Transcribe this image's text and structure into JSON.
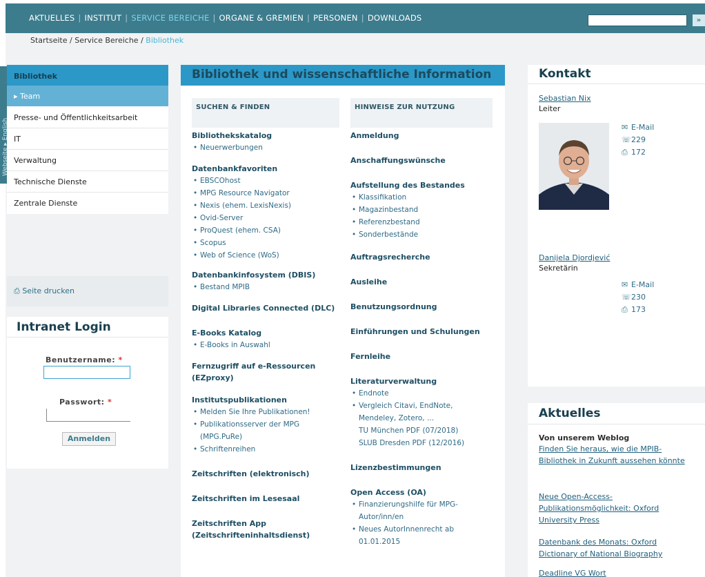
{
  "nav": {
    "items": [
      "AKTUELLES",
      "INSTITUT",
      "SERVICE BEREICHE",
      "ORGANE & GREMIEN",
      "PERSONEN",
      "DOWNLOADS"
    ],
    "active_index": 2,
    "search_button": "»"
  },
  "breadcrumb": {
    "part1": "Startseite",
    "part2": "Service Bereiche",
    "current": "Bibliothek",
    "sep": " / "
  },
  "side_tab": "Webseite ▸ English",
  "left_menu": {
    "title": "Bibliothek",
    "items": [
      {
        "label": "▸ Team",
        "active": true
      },
      {
        "label": "Presse- und Öffentlichkeitsarbeit"
      },
      {
        "label": "IT"
      },
      {
        "label": "Verwaltung"
      },
      {
        "label": "Technische Dienste"
      },
      {
        "label": "Zentrale Dienste"
      }
    ]
  },
  "print": {
    "label": "Seite drucken"
  },
  "login": {
    "title": "Intranet Login",
    "username_label": "Benutzername:",
    "password_label": "Passwort:",
    "required_mark": "*",
    "submit": "Anmelden"
  },
  "main": {
    "title": "Bibliothek und wissenschaftliche Information",
    "col1_head": "SUCHEN & FINDEN",
    "col2_head": "HINWEISE ZUR NUTZUNG",
    "col1": [
      {
        "title": "Bibliothekskatalog",
        "items": [
          "Neuerwerbungen"
        ]
      },
      {
        "title": "Datenbankfavoriten",
        "items": [
          "EBSCOhost",
          "MPG Resource Navigator",
          "Nexis (ehem. LexisNexis)",
          "Ovid-Server",
          "ProQuest (ehem. CSA)",
          "Scopus",
          "Web of Science (WoS)"
        ]
      },
      {
        "title": "Datenbankinfosystem (DBIS)",
        "items": [
          "Bestand MPIB"
        ]
      },
      {
        "title": "Digital Libraries Connected (DLC)",
        "items": []
      },
      {
        "title": "E-Books Katalog",
        "items": [
          "E-Books in Auswahl"
        ]
      },
      {
        "title": "Fernzugriff auf e-Ressourcen",
        "title2": "(EZproxy)",
        "items": []
      },
      {
        "title": "Institutspublikationen",
        "items": [
          "Melden Sie Ihre Publikationen!",
          "Publikationsserver der MPG",
          "Schriftenreihen"
        ],
        "item_extra": "(MPG.PuRe)"
      },
      {
        "title": "Zeitschriften (elektronisch)",
        "items": []
      },
      {
        "title": "Zeitschriften im Lesesaal",
        "items": []
      },
      {
        "title": "Zeitschriften App",
        "title2": "(Zeitschrifteninhaltsdienst)",
        "items": []
      }
    ],
    "col2": [
      {
        "title": "Anmeldung",
        "items": []
      },
      {
        "title": "Anschaffungswünsche",
        "items": []
      },
      {
        "title": "Aufstellung des Bestandes",
        "items": [
          "Klassifikation",
          "Magazinbestand",
          "Referenzbestand",
          "Sonderbestände"
        ]
      },
      {
        "title": "Auftragsrecherche",
        "items": []
      },
      {
        "title": "Ausleihe",
        "items": []
      },
      {
        "title": "Benutzungsordnung",
        "items": []
      },
      {
        "title": "Einführungen und Schulungen",
        "items": []
      },
      {
        "title": "Fernleihe",
        "items": []
      },
      {
        "title": "Literaturverwaltung",
        "items": [
          "Endnote",
          "Vergleich Citavi, EndNote,"
        ],
        "extra_lines": [
          "Mendeley, Zotero, ...",
          "TU München PDF (07/2018)",
          "SLUB Dresden PDF (12/2016)"
        ]
      },
      {
        "title": "Lizenzbestimmungen",
        "items": []
      },
      {
        "title": "Open Access (OA)",
        "items": [
          "Finanzierungshilfe für MPG-",
          "Neues AutorInnenrecht ab"
        ],
        "extra_oa": [
          "Autor/inn/en",
          "01.01.2015"
        ]
      }
    ]
  },
  "contact": {
    "title": "Kontakt",
    "p1": {
      "name": "Sebastian Nix",
      "role": "Leiter",
      "email": "E-Mail",
      "phone": "229",
      "fax": "172"
    },
    "p2": {
      "name": "Danijela Djordjević",
      "role": "Sekretärin",
      "email": "E-Mail",
      "phone": "230",
      "fax": "173"
    }
  },
  "news": {
    "title": "Aktuelles",
    "subtitle": "Von unserem Weblog",
    "links": [
      "Finden Sie heraus, wie die MPIB-Bibliothek in Zukunft aussehen könnte",
      "Neue Open-Access-Publikationsmöglichkeit: Oxford University Press",
      "Datenbank des Monats: Oxford Dictionary of National Biography",
      "Deadline VG Wort"
    ]
  }
}
